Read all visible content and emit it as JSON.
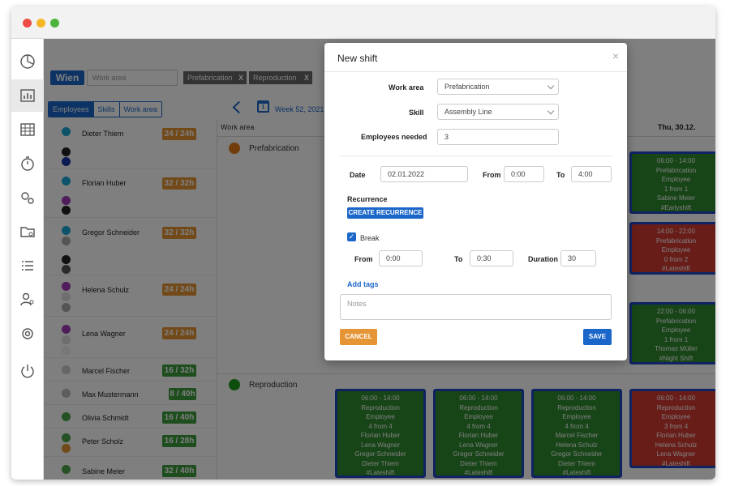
{
  "header": {
    "city": "Wien",
    "work_area_placeholder": "Work area",
    "filters": [
      "Prefabrication",
      "Reproduction"
    ],
    "filter_remove": "X"
  },
  "tabs": [
    "Employees",
    "Skills",
    "Work area"
  ],
  "week": {
    "label": "Week 52, 2021",
    "calendar_day": "1"
  },
  "columns": {
    "work_area": "Work area",
    "thu": "Thu, 30.12."
  },
  "areas": {
    "prefabrication": "Prefabrication",
    "reproduction": "Reproduction"
  },
  "employees": [
    {
      "name": "Dieter Thiem",
      "hours": "24 / 24h"
    },
    {
      "name": "Florian Huber",
      "hours": "32 / 32h"
    },
    {
      "name": "Gregor Schneider",
      "hours": "32 / 32h"
    },
    {
      "name": "Helena Schulz",
      "hours": "24 / 24h"
    },
    {
      "name": "Lena Wagner",
      "hours": "24 / 24h"
    },
    {
      "name": "Marcel Fischer",
      "hours": "16 / 32h"
    },
    {
      "name": "Max Mustermann",
      "hours": "8 / 40h"
    },
    {
      "name": "Olivia Schmidt",
      "hours": "16 / 40h"
    },
    {
      "name": "Peter Scholz",
      "hours": "16 / 28h"
    },
    {
      "name": "Sabine Meier",
      "hours": "32 / 40h"
    }
  ],
  "shifts_right": [
    {
      "time": "06:00 - 14:00",
      "area": "Prefabrication",
      "role": "Employee",
      "count": "1 from 1",
      "people": [
        "Sabine Meier"
      ],
      "tag": "#Earlyshift"
    },
    {
      "time": "14:00 - 22:00",
      "area": "Prefabrication",
      "role": "Employee",
      "count": "0 from 2",
      "people": [],
      "tag": "#Lateshift"
    },
    {
      "time": "22:00 - 06:00",
      "area": "Prefabrication",
      "role": "Employee",
      "count": "1 from 1",
      "people": [
        "Thomas Müller"
      ],
      "tag": "#Night Shift"
    }
  ],
  "shifts_bottom": [
    {
      "time": "06:00 - 14:00",
      "area": "Reproduction",
      "role": "Employee",
      "count": "4 from 4",
      "people": [
        "Florian Huber",
        "Lena Wagner",
        "Gregor Schneider",
        "Dieter Thiem"
      ],
      "tag": "#Lateshift"
    },
    {
      "time": "06:00 - 14:00",
      "area": "Reproduction",
      "role": "Employee",
      "count": "4 from 4",
      "people": [
        "Florian Huber",
        "Lena Wagner",
        "Gregor Schneider",
        "Dieter Thiem"
      ],
      "tag": "#Lateshift"
    },
    {
      "time": "06:00 - 14:00",
      "area": "Reproduction",
      "role": "Employee",
      "count": "4 from 4",
      "people": [
        "Marcel Fischer",
        "Helena Schulz",
        "Gregor Schneider",
        "Dieter Thiem"
      ],
      "tag": "#Lateshift"
    },
    {
      "time": "06:00 - 14:00",
      "area": "Reproduction",
      "role": "Employee",
      "count": "3 from 4",
      "people": [
        "Florian Huber",
        "Helena Schulz",
        "Lena Wagner"
      ],
      "tag": "#Lateshift"
    }
  ],
  "modal": {
    "title": "New shift",
    "close": "×",
    "work_area_label": "Work area",
    "work_area_value": "Prefabrication",
    "skill_label": "Skill",
    "skill_value": "Assembly Line",
    "employees_label": "Employees needed",
    "employees_value": "3",
    "date_label": "Date",
    "date_value": "02.01.2022",
    "from_label": "From",
    "from_value": "0:00",
    "to_label": "To",
    "to_value": "4:00",
    "recurrence_label": "Recurrence",
    "recurrence_button": "CREATE RECURRENCE",
    "break_label": "Break",
    "break_from_label": "From",
    "break_from_value": "0:00",
    "break_to_label": "To",
    "break_to_value": "0:30",
    "duration_label": "Duration",
    "duration_value": "30",
    "add_tags": "Add tags",
    "notes_placeholder": "Notes",
    "cancel": "CANCEL",
    "save": "SAVE"
  },
  "colors": {
    "accent_blue": "#1976d2",
    "orange": "#e59535",
    "green_badge": "#3d9a3d",
    "card_green": "#2e8b2e",
    "card_red": "#d23b32"
  }
}
